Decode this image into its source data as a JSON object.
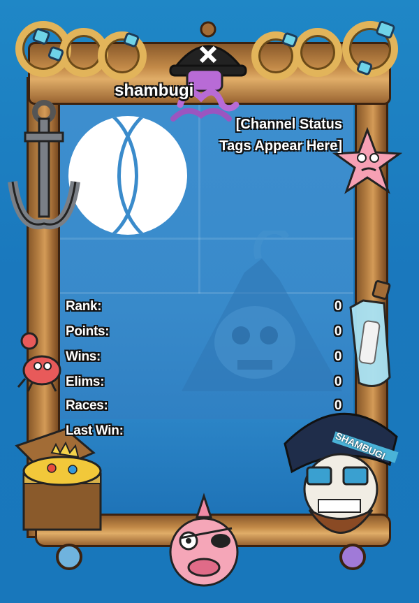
{
  "card": {
    "username": "shambugi",
    "status_tags": "[Channel Status Tags Appear Here]",
    "status_line1": "[Channel Status",
    "status_line2": "Tags Appear Here]"
  },
  "stats": [
    {
      "label": "Rank:",
      "value": "0"
    },
    {
      "label": "Points:",
      "value": "0"
    },
    {
      "label": "Wins:",
      "value": "0"
    },
    {
      "label": "Elims:",
      "value": "0"
    },
    {
      "label": "Races:",
      "value": "0"
    },
    {
      "label": "Last Win:",
      "value": ""
    }
  ],
  "hat_text": "SHAMBUGI",
  "colors": {
    "background": "#1a78bd",
    "wood": "#b07a3f",
    "rope": "#e2b45a",
    "outline": "#111111",
    "text": "#ffffff"
  },
  "icons": [
    "pirate-hat-icon",
    "octopus-icon",
    "anchor-icon",
    "starfish-icon",
    "bottle-message-icon",
    "crab-icon",
    "treasure-chest-icon",
    "skull-pirate-icon",
    "pufferfish-icon",
    "island-skull-icon"
  ]
}
